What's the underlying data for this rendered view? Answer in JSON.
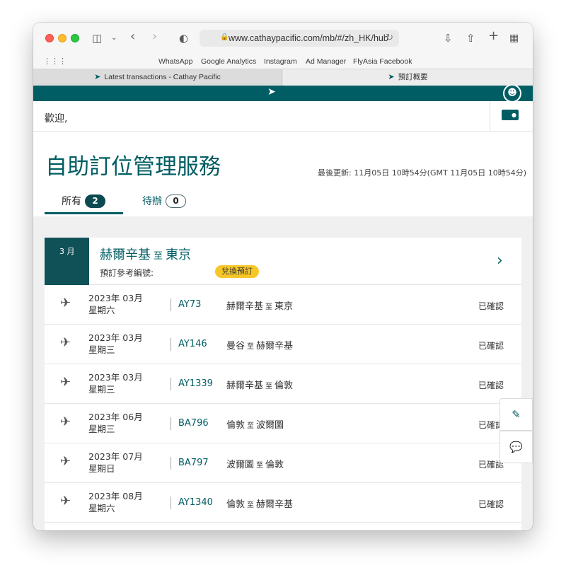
{
  "browser": {
    "url": "www.cathaypacific.com/mb/#/zh_HK/hub",
    "bookmarks": [
      "WhatsApp",
      "Google Analytics",
      "Instagram",
      "Ad Manager",
      "FlyAsia Facebook"
    ],
    "tabs": [
      {
        "title": "Latest transactions - Cathay Pacific"
      },
      {
        "title": "預訂概要"
      }
    ]
  },
  "header": {
    "welcome": "歡迎,",
    "title": "自助訂位管理服務",
    "last_updated": "最後更新:  11月05日 10時54分(GMT 11月05日 10時54分)"
  },
  "filter_tabs": [
    {
      "label": "所有",
      "count": "2"
    },
    {
      "label": "待辦",
      "count": "0"
    }
  ],
  "booking": {
    "month": "3 月",
    "origin": "赫爾辛基",
    "to_word": "至",
    "destination": "東京",
    "ref_label": "預訂參考編號:",
    "badge": "兌換預訂"
  },
  "flights": [
    {
      "date": "2023年 03月",
      "weekday": "星期六",
      "flight": "AY73",
      "from": "赫爾辛基",
      "to": "東京",
      "status": "已確認"
    },
    {
      "date": "2023年 03月",
      "weekday": "星期三",
      "flight": "AY146",
      "from": "曼谷",
      "to": "赫爾辛基",
      "status": "已確認"
    },
    {
      "date": "2023年 03月",
      "weekday": "星期三",
      "flight": "AY1339",
      "from": "赫爾辛基",
      "to": "倫敦",
      "status": "已確認"
    },
    {
      "date": "2023年 06月",
      "weekday": "星期三",
      "flight": "BA796",
      "from": "倫敦",
      "to": "波爾圖",
      "status": "已確認"
    },
    {
      "date": "2023年 07月",
      "weekday": "星期日",
      "flight": "BA797",
      "from": "波爾圖",
      "to": "倫敦",
      "status": "已確認"
    },
    {
      "date": "2023年 08月",
      "weekday": "星期六",
      "flight": "AY1340",
      "from": "倫敦",
      "to": "赫爾辛基",
      "status": "已確認"
    }
  ],
  "colors": {
    "brand": "#005d63",
    "badge": "#f7c728"
  }
}
